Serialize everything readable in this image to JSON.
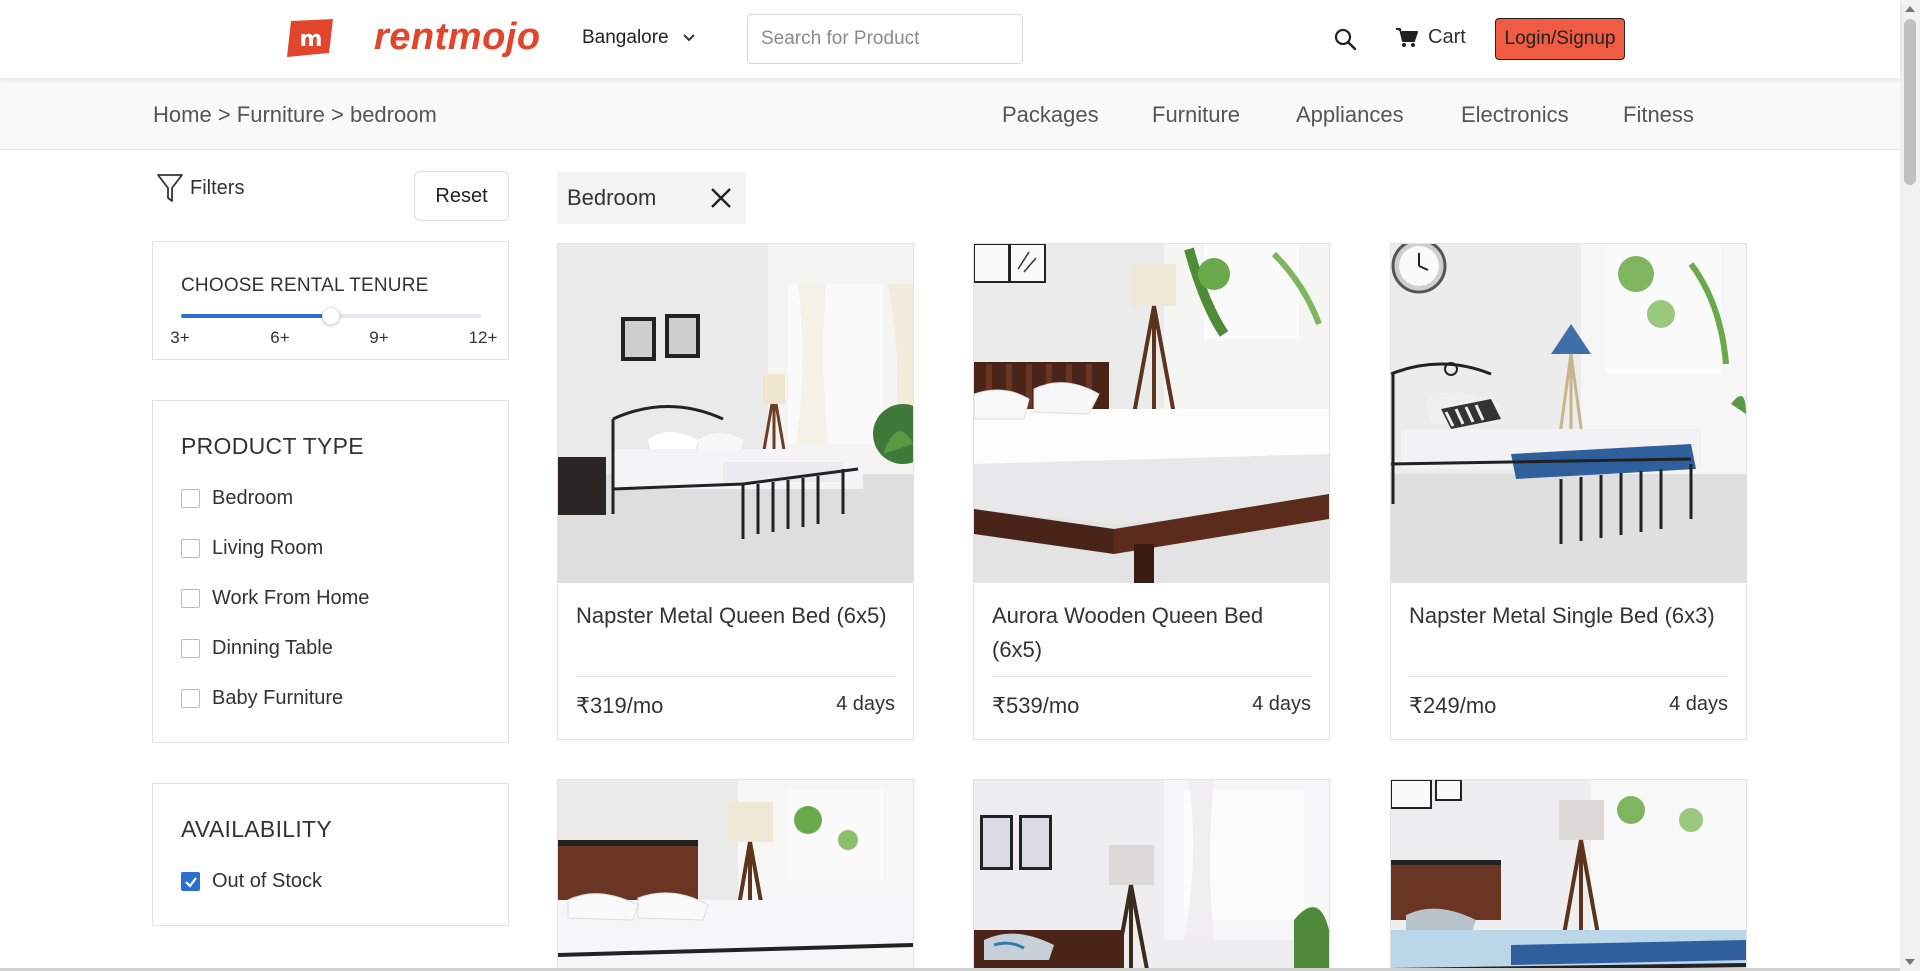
{
  "header": {
    "brand": "rentmojo",
    "city": "Bangalore",
    "search_placeholder": "Search for Product",
    "cart_label": "Cart",
    "login_label": "Login/Signup"
  },
  "breadcrumb": [
    "Home",
    "Furniture",
    "bedroom"
  ],
  "breadcrumb_sep": ">",
  "category_nav": [
    "Packages",
    "Furniture",
    "Appliances",
    "Electronics",
    "Fitness"
  ],
  "sidebar": {
    "filters_label": "Filters",
    "reset_label": "Reset",
    "tenure": {
      "title": "CHOOSE RENTAL TENURE",
      "ticks": [
        "3+",
        "6+",
        "9+",
        "12+"
      ],
      "selected_fraction": 0.5
    },
    "product_type": {
      "title": "PRODUCT TYPE",
      "options": [
        {
          "label": "Bedroom",
          "checked": false
        },
        {
          "label": "Living Room",
          "checked": false
        },
        {
          "label": "Work From Home",
          "checked": false
        },
        {
          "label": "Dinning Table",
          "checked": false
        },
        {
          "label": "Baby Furniture",
          "checked": false
        }
      ]
    },
    "availability": {
      "title": "AVAILABILITY",
      "options": [
        {
          "label": "Out of Stock",
          "checked": true
        }
      ]
    }
  },
  "active_filter": {
    "label": "Bedroom"
  },
  "products": [
    {
      "title": "Napster Metal Queen Bed (6x5)",
      "price": "₹319/mo",
      "delivery": "4 days"
    },
    {
      "title": "Aurora Wooden Queen Bed (6x5)",
      "price": "₹539/mo",
      "delivery": "4 days"
    },
    {
      "title": "Napster Metal Single Bed (6x3)",
      "price": "₹249/mo",
      "delivery": "4 days"
    }
  ],
  "colors": {
    "brand": "#e1462d",
    "login_bg": "#f05b43",
    "accent": "#2d6fcf"
  }
}
